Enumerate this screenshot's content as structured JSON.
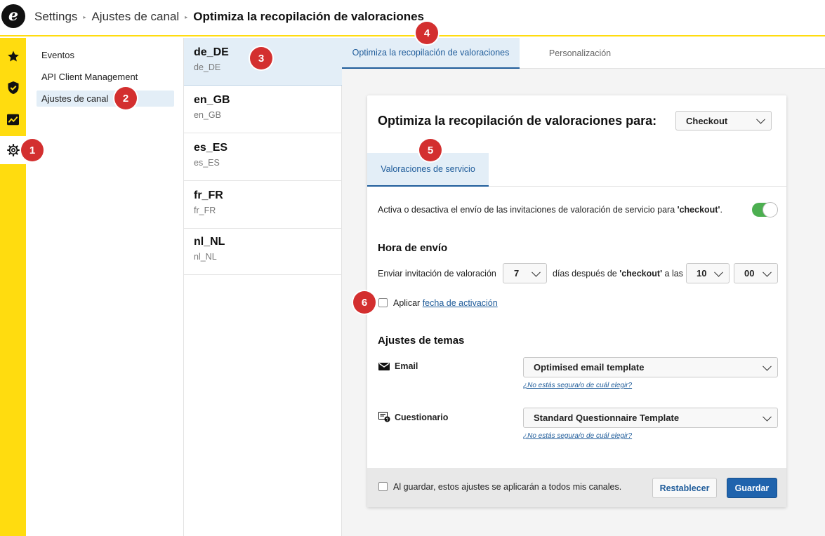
{
  "breadcrumb": {
    "items": [
      "Settings",
      "Ajustes de canal",
      "Optimiza la recopilación de valoraciones"
    ]
  },
  "rail": {
    "icons": [
      "star-icon",
      "shield-check-icon",
      "analytics-icon",
      "gear-icon"
    ]
  },
  "subnav": {
    "items": [
      "Eventos",
      "API Client Management",
      "Ajustes de canal"
    ],
    "active_index": 2
  },
  "locales": [
    {
      "title": "de_DE",
      "sub": "de_DE"
    },
    {
      "title": "en_GB",
      "sub": "en_GB"
    },
    {
      "title": "es_ES",
      "sub": "es_ES"
    },
    {
      "title": "fr_FR",
      "sub": "fr_FR"
    },
    {
      "title": "nl_NL",
      "sub": "nl_NL"
    }
  ],
  "tabs": {
    "optimize": "Optimiza la recopilación de valoraciones",
    "personalize": "Personalización"
  },
  "card": {
    "title": "Optimiza la recopilación de valoraciones para:",
    "trigger_select": "Checkout",
    "inner_tab": "Valoraciones de servicio",
    "toggle_text_before": "Activa o desactiva el envío de las invitaciones de valoración de servicio para ",
    "toggle_text_bold": "'checkout'",
    "toggle_text_after": ".",
    "toggle_on": true,
    "send_time": {
      "title": "Hora de envío",
      "label": "Enviar invitación de valoración",
      "days": "7",
      "middle_before": "días después de ",
      "middle_bold": "'checkout'",
      "middle_after": " a las",
      "hour": "10",
      "minute": "00"
    },
    "activation": {
      "label": "Aplicar ",
      "link": "fecha de activación"
    },
    "themes": {
      "title": "Ajustes de temas",
      "email_label": "Email",
      "email_template": "Optimised email template",
      "questionnaire_label": "Cuestionario",
      "questionnaire_template": "Standard Questionnaire Template",
      "help_link": "¿No estás segura/o de cuál elegir?"
    },
    "footer": {
      "apply_all": "Al guardar, estos ajustes se aplicarán a todos mis canales.",
      "reset": "Restablecer",
      "save": "Guardar"
    }
  },
  "markers": [
    "1",
    "2",
    "3",
    "4",
    "5",
    "6"
  ],
  "colors": {
    "brand_yellow": "#ffdc0f",
    "accent_blue": "#1f5c9a",
    "toggle_green": "#4caf50",
    "marker_red": "#d32f2f"
  }
}
